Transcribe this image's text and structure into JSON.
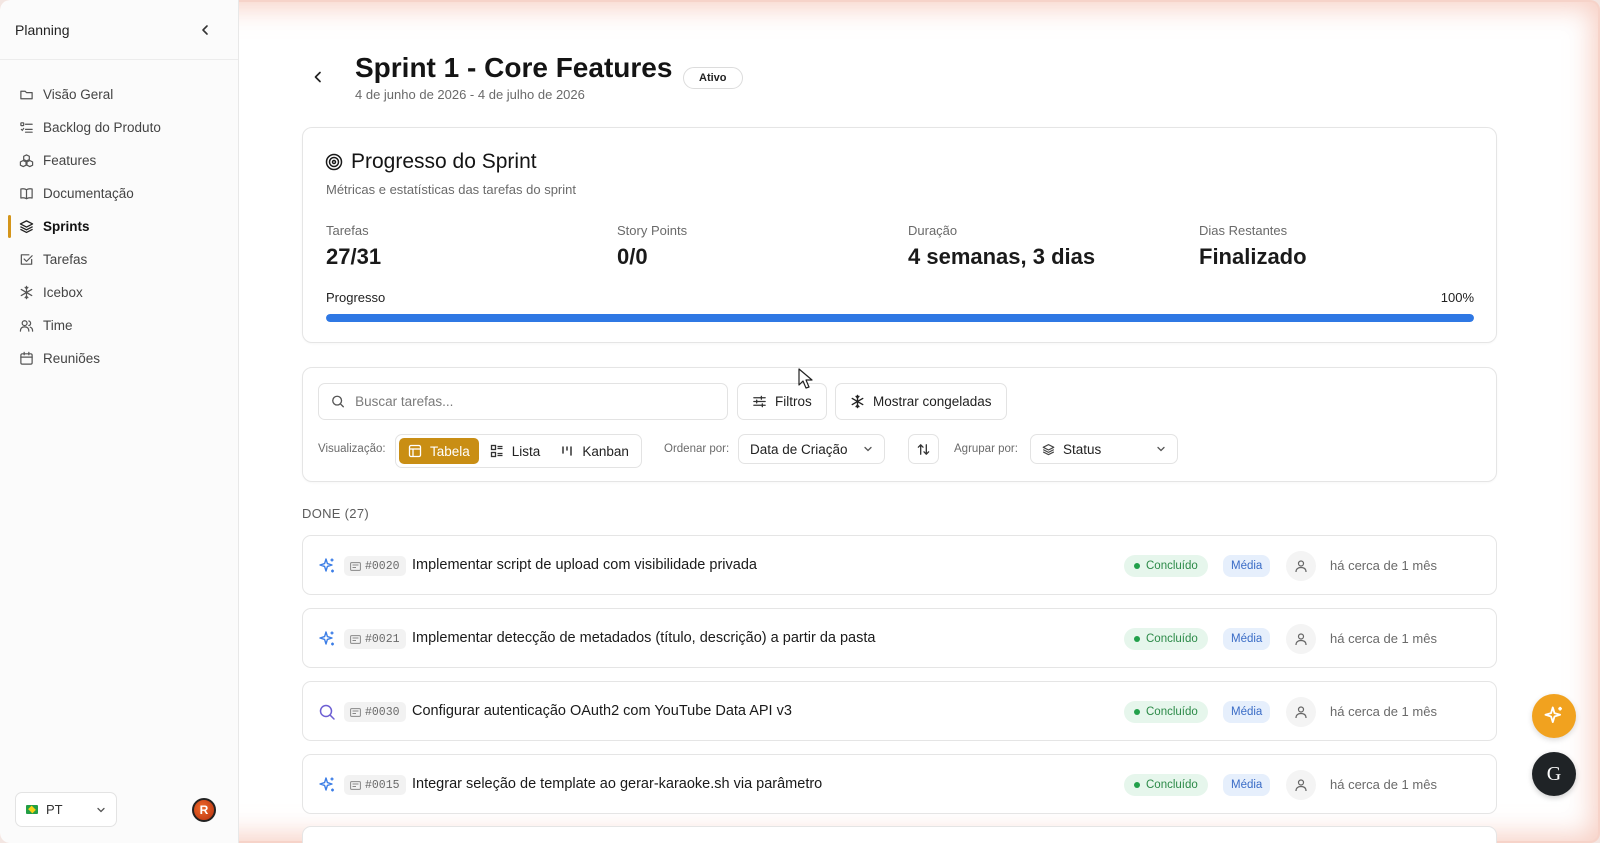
{
  "sidebar": {
    "title": "Planning",
    "items": [
      {
        "label": "Visão Geral",
        "icon": "folder-icon",
        "active": false
      },
      {
        "label": "Backlog do Produto",
        "icon": "list-icon",
        "active": false
      },
      {
        "label": "Features",
        "icon": "boxes-icon",
        "active": false
      },
      {
        "label": "Documentação",
        "icon": "book-icon",
        "active": false
      },
      {
        "label": "Sprints",
        "icon": "layers-icon",
        "active": true
      },
      {
        "label": "Tarefas",
        "icon": "checkbox-icon",
        "active": false
      },
      {
        "label": "Icebox",
        "icon": "snowflake-icon",
        "active": false
      },
      {
        "label": "Time",
        "icon": "users-icon",
        "active": false
      },
      {
        "label": "Reuniões",
        "icon": "calendar-icon",
        "active": false
      }
    ],
    "language": "PT",
    "avatar_initial": "R"
  },
  "header": {
    "title": "Sprint 1 - Core Features",
    "status_badge": "Ativo",
    "dates": "4 de junho de 2026 - 4 de julho de 2026"
  },
  "progress": {
    "title": "Progresso do Sprint",
    "subtitle": "Métricas e estatísticas das tarefas do sprint",
    "metrics": [
      {
        "label": "Tarefas",
        "value": "27/31"
      },
      {
        "label": "Story Points",
        "value": "0/0"
      },
      {
        "label": "Duração",
        "value": "4 semanas, 3 dias"
      },
      {
        "label": "Dias Restantes",
        "value": "Finalizado"
      }
    ],
    "bar_label": "Progresso",
    "percent_label": "100%",
    "percent": 100,
    "bar_color": "#2f78e4"
  },
  "filters": {
    "search_placeholder": "Buscar tarefas...",
    "filters_label": "Filtros",
    "frozen_label": "Mostrar congeladas",
    "view_label": "Visualização:",
    "views": [
      {
        "label": "Tabela",
        "active": true
      },
      {
        "label": "Lista",
        "active": false
      },
      {
        "label": "Kanban",
        "active": false
      }
    ],
    "sort_label": "Ordenar por:",
    "sort_value": "Data de Criação",
    "group_label": "Agrupar por:",
    "group_value": "Status",
    "accent": "#c98e14"
  },
  "group": {
    "heading": "DONE (27)",
    "tasks": [
      {
        "icon": "sparkles-icon",
        "id": "#0020",
        "title": "Implementar script de upload com visibilidade privada",
        "status": "Concluído",
        "priority": "Média",
        "time": "há cerca de 1 mês"
      },
      {
        "icon": "sparkles-icon",
        "id": "#0021",
        "title": "Implementar detecção de metadados (título, descrição) a partir da pasta",
        "status": "Concluído",
        "priority": "Média",
        "time": "há cerca de 1 mês"
      },
      {
        "icon": "search-icon",
        "id": "#0030",
        "title": "Configurar autenticação OAuth2 com YouTube Data API v3",
        "status": "Concluído",
        "priority": "Média",
        "time": "há cerca de 1 mês"
      },
      {
        "icon": "sparkles-icon",
        "id": "#0015",
        "title": "Integrar seleção de template ao gerar-karaoke.sh via parâmetro",
        "status": "Concluído",
        "priority": "Média",
        "time": "há cerca de 1 mês"
      }
    ]
  },
  "fab": {
    "g_label": "G"
  }
}
